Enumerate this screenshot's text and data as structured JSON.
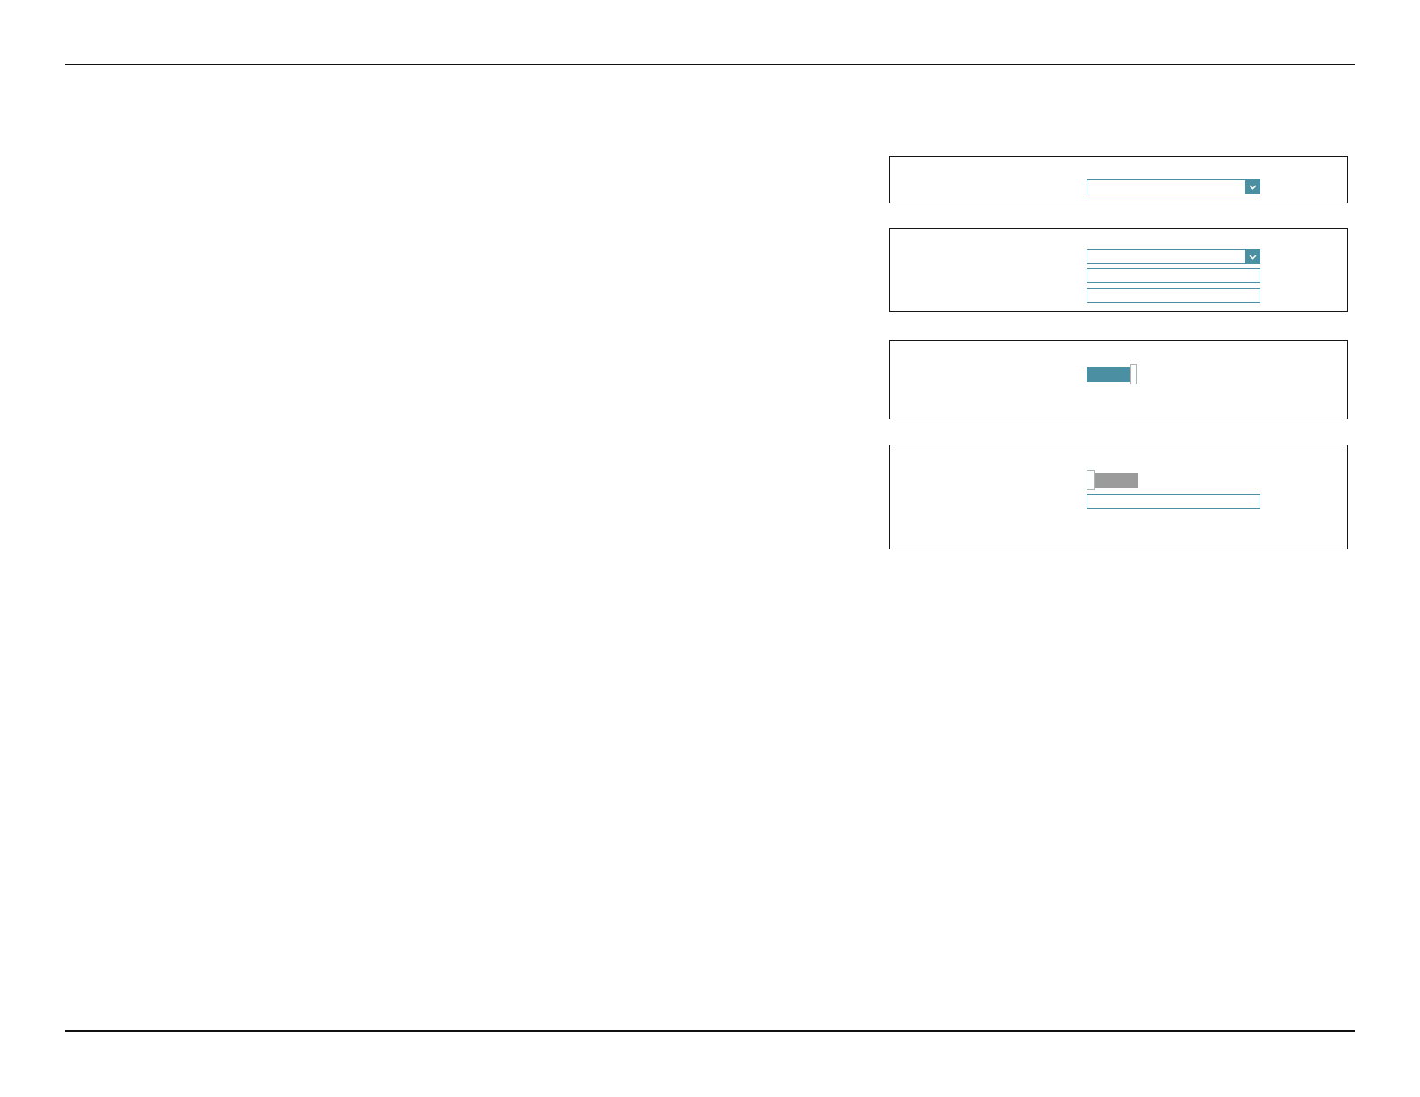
{
  "panels": [
    {
      "controls": [
        {
          "kind": "dropdown"
        }
      ]
    },
    {
      "controls": [
        {
          "kind": "dropdown"
        },
        {
          "kind": "text_input"
        },
        {
          "kind": "text_input"
        }
      ]
    },
    {
      "controls": [
        {
          "kind": "toggle",
          "on": true
        }
      ]
    },
    {
      "controls": [
        {
          "kind": "toggle",
          "on": false
        },
        {
          "kind": "text_input"
        }
      ]
    }
  ]
}
